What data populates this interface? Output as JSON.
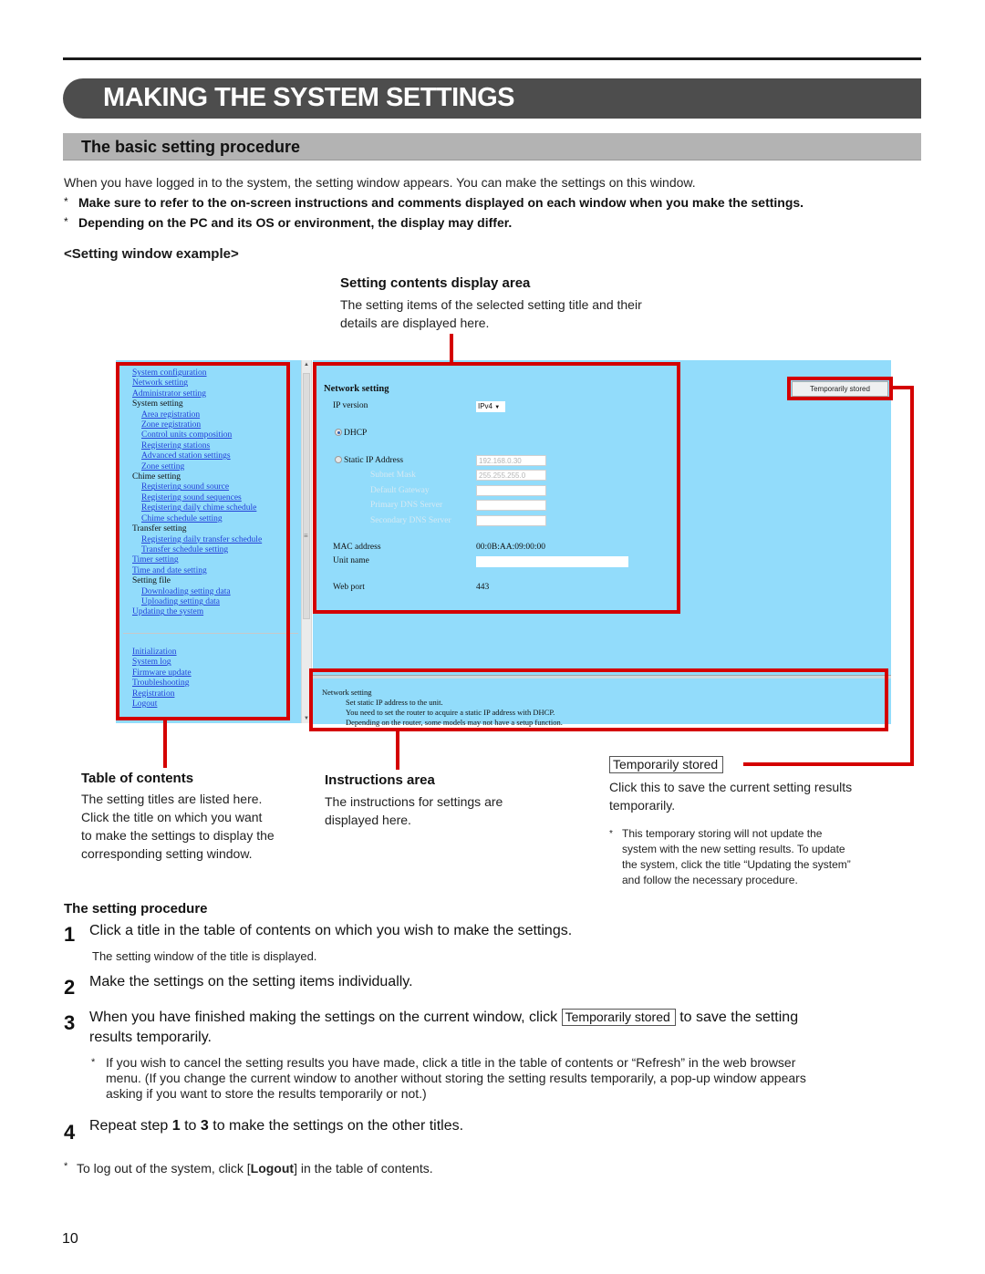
{
  "page": {
    "title": "MAKING THE SYSTEM SETTINGS",
    "section_title": "The basic setting procedure",
    "intro": "When you have logged in to the system, the setting window appears. You can make the settings on this window.",
    "notes": [
      "Make sure to refer to the on-screen instructions and comments displayed on each window when you make the settings.",
      "Depending on the PC and its OS or environment, the display may differ."
    ],
    "star": "*",
    "example_label": "<Setting window example>",
    "page_number": "10"
  },
  "callouts": {
    "contents": {
      "title": "Setting contents display area",
      "lines": [
        "The setting items of the selected setting title and their",
        "details are displayed here."
      ]
    },
    "toc": {
      "title": "Table of contents",
      "lines": [
        "The setting titles are listed here.",
        "Click the title on which you want",
        "to make the settings to display the",
        "corresponding setting window."
      ]
    },
    "instructions": {
      "title": "Instructions area",
      "lines": [
        "The instructions for settings are",
        "displayed here."
      ]
    },
    "temp": {
      "button_label": "Temporarily stored",
      "lines": [
        "Click this to save the current setting results",
        "temporarily."
      ],
      "note_lines": [
        "This temporary storing will not update the",
        "system with the new setting results. To update",
        "the system, click the title “Updating the system”",
        "and follow the necessary procedure."
      ]
    }
  },
  "window": {
    "toc_items": [
      {
        "label": "System configuration",
        "type": "link",
        "indent": false
      },
      {
        "label": "Network setting",
        "type": "link",
        "indent": false
      },
      {
        "label": "Administrator setting",
        "type": "link",
        "indent": false
      },
      {
        "label": "System setting",
        "type": "header",
        "indent": false
      },
      {
        "label": "Area registration",
        "type": "link",
        "indent": true
      },
      {
        "label": "Zone registration",
        "type": "link",
        "indent": true
      },
      {
        "label": "Control units composition",
        "type": "link",
        "indent": true
      },
      {
        "label": "Registering stations",
        "type": "link",
        "indent": true
      },
      {
        "label": "Advanced station settings",
        "type": "link",
        "indent": true
      },
      {
        "label": "Zone setting",
        "type": "link",
        "indent": true
      },
      {
        "label": "Chime setting",
        "type": "header",
        "indent": false
      },
      {
        "label": "Registering sound source",
        "type": "link",
        "indent": true
      },
      {
        "label": "Registering sound sequences",
        "type": "link",
        "indent": true
      },
      {
        "label": "Registering daily chime schedule",
        "type": "link",
        "indent": true
      },
      {
        "label": "Chime schedule setting",
        "type": "link",
        "indent": true
      },
      {
        "label": "Transfer setting",
        "type": "header",
        "indent": false
      },
      {
        "label": "Registering daily transfer schedule",
        "type": "link",
        "indent": true
      },
      {
        "label": "Transfer schedule setting",
        "type": "link",
        "indent": true
      },
      {
        "label": "Timer setting",
        "type": "link",
        "indent": false
      },
      {
        "label": "Time and date setting",
        "type": "link",
        "indent": false
      },
      {
        "label": "Setting file",
        "type": "header",
        "indent": false
      },
      {
        "label": "Downloading setting data",
        "type": "link",
        "indent": true
      },
      {
        "label": "Uploading setting data",
        "type": "link",
        "indent": true
      },
      {
        "label": "Updating the system",
        "type": "link",
        "indent": false
      }
    ],
    "toc_bottom": [
      "Initialization",
      "System log",
      "Firmware update",
      "Troubleshooting",
      "Registration",
      "Logout"
    ],
    "network": {
      "heading": "Network setting",
      "ip_version_label": "IP version",
      "ip_version_value": "IPv4",
      "dhcp_label": "DHCP",
      "dhcp_selected": true,
      "static_label": "Static IP Address",
      "static_value": "192.168.0.30",
      "subnet_label": "Subnet Mask",
      "subnet_value": "255.255.255.0",
      "gateway_label": "Default Gateway",
      "gateway_value": "",
      "dns1_label": "Primary DNS Server",
      "dns1_value": "",
      "dns2_label": "Secondary DNS Server",
      "dns2_value": "",
      "mac_label": "MAC address",
      "mac_value": "00:0B:AA:09:00:00",
      "unit_label": "Unit name",
      "unit_value": "",
      "port_label": "Web port",
      "port_value": "443"
    },
    "temp_button": "Temporarily stored",
    "instructions": {
      "heading": "Network setting",
      "lines": [
        "Set static IP address to the unit.",
        "You need to set the router to acquire a static IP address with DHCP.",
        "Depending on the router, some models may not have a setup function."
      ]
    }
  },
  "procedure": {
    "heading": "The setting procedure",
    "steps": [
      {
        "num": "1",
        "text": "Click a title in the table of contents on which you wish to make the settings.",
        "sub": "The setting window of the title is displayed."
      },
      {
        "num": "2",
        "text": "Make the settings on the setting items individually."
      },
      {
        "num": "3",
        "text_before": "When you have finished making the settings on the current window, click",
        "button": "Temporarily stored",
        "text_after": "to save the setting",
        "text_line2": "results temporarily.",
        "note_lines": [
          "If you wish to cancel the setting results you have made, click a title in the table of contents or “Refresh” in the web browser",
          "menu. (If you change the current window to another without storing the setting results temporarily, a pop-up window appears",
          "asking if you want to store the results temporarily or not.)"
        ]
      },
      {
        "num": "4",
        "text_before": "Repeat step",
        "from": "1",
        "mid": "to",
        "to": "3",
        "text_after": "to make the settings on the other titles."
      }
    ],
    "logout_note_before": "To log out of the system, click [",
    "logout_bold": "Logout",
    "logout_note_after": "] in the table of contents."
  },
  "colors": {
    "callout_red": "#d40000",
    "window_bg": "#92dcfb",
    "link_blue": "#2340d8",
    "title_bar": "#4d4d4d",
    "section_bar": "#b3b3b3"
  }
}
